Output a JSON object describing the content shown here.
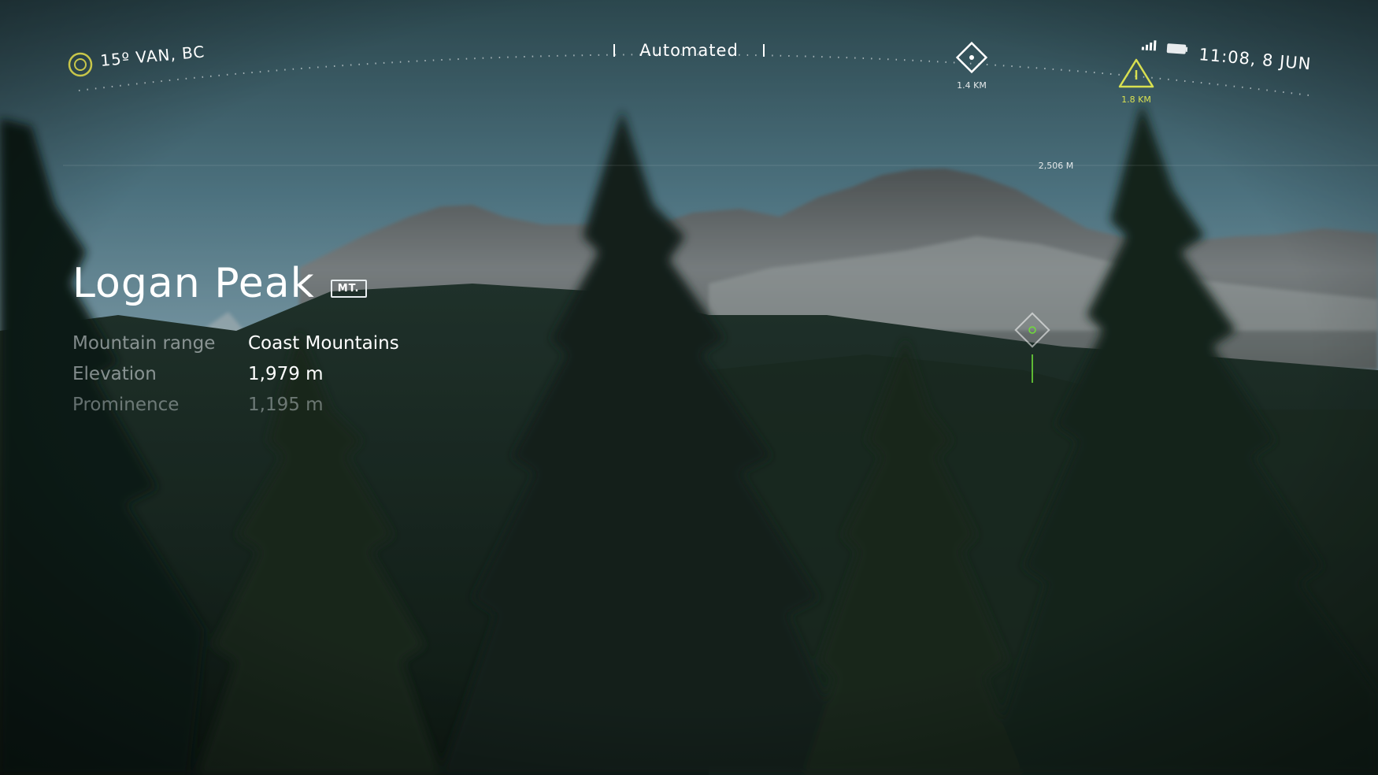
{
  "weather": {
    "icon": "sun-ring-icon",
    "text": "15º VAN, BC"
  },
  "mode": {
    "label": "Automated"
  },
  "status": {
    "signal_icon": "signal-bars-icon",
    "battery_icon": "battery-icon",
    "time": "11:08, 8 JUN"
  },
  "waypoints": [
    {
      "icon": "waypoint-diamond-icon",
      "distance": "1.4 KM"
    },
    {
      "icon": "warning-triangle-icon",
      "distance": "1.8 KM"
    }
  ],
  "altitude_marker": "2,506 M",
  "peak": {
    "name": "Logan Peak",
    "badge": "MT.",
    "details": [
      {
        "label": "Mountain range",
        "value": "Coast Mountains"
      },
      {
        "label": "Elevation",
        "value": "1,979 m"
      },
      {
        "label": "Prominence",
        "value": "1,195 m"
      }
    ]
  },
  "colors": {
    "accent_yellow": "#d8e050",
    "accent_green": "#6fdc3a",
    "hud_white": "#ffffff"
  }
}
